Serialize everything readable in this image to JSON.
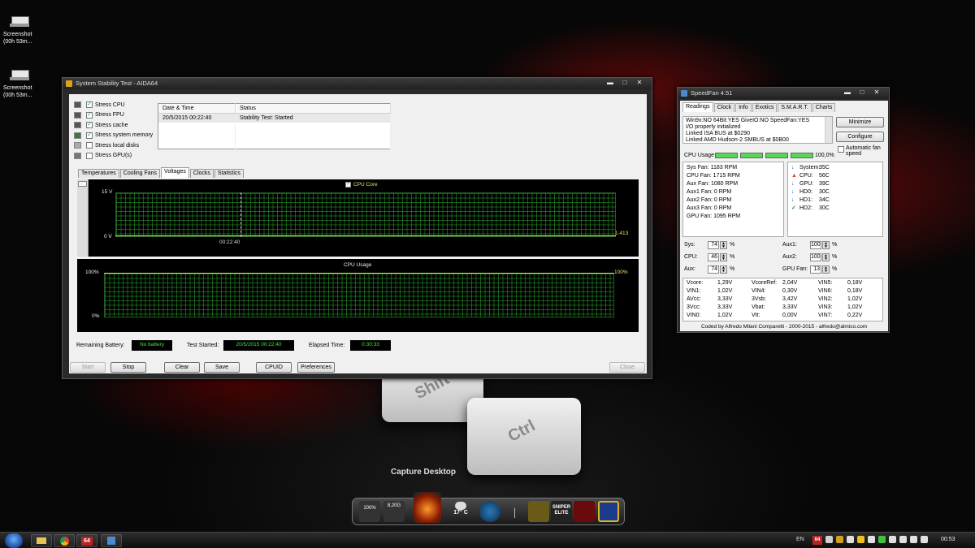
{
  "desktop": {
    "icons": [
      {
        "label": "Screenshot (00h 53m..."
      },
      {
        "label": "Screenshot (00h 53m..."
      }
    ],
    "capture_label": "Capture Desktop",
    "keys": [
      "Shift",
      "Ctrl"
    ]
  },
  "aida": {
    "title": "System Stability Test - AIDA64",
    "stress_items": [
      {
        "label": "Stress CPU",
        "checked": true
      },
      {
        "label": "Stress FPU",
        "checked": true
      },
      {
        "label": "Stress cache",
        "checked": true
      },
      {
        "label": "Stress system memory",
        "checked": true
      },
      {
        "label": "Stress local disks",
        "checked": false
      },
      {
        "label": "Stress GPU(s)",
        "checked": false
      }
    ],
    "log_headers": [
      "Date & Time",
      "Status"
    ],
    "log_rows": [
      [
        "20/5/2015 00:22:40",
        "Stability Test: Started"
      ]
    ],
    "tabs": [
      "Temperatures",
      "Cooling Fans",
      "Voltages",
      "Clocks",
      "Statistics"
    ],
    "active_tab": "Voltages",
    "graph1": {
      "legend": "CPU Core",
      "y_max": "15 V",
      "y_min": "0 V",
      "x_label": "00:22:40",
      "value": "1.413",
      "color": "#e8e060"
    },
    "graph2": {
      "title": "CPU Usage",
      "y_max": "100%",
      "y_min": "0%",
      "value": "100%",
      "color": "#e8e060"
    },
    "status": {
      "battery_label": "Remaining Battery:",
      "battery_value": "No battery",
      "started_label": "Test Started:",
      "started_value": "20/5/2015 00:22:40",
      "elapsed_label": "Elapsed Time:",
      "elapsed_value": "0:30:33"
    },
    "buttons": [
      "Start",
      "Stop",
      "Clear",
      "Save",
      "CPUID",
      "Preferences",
      "Close"
    ]
  },
  "speedfan": {
    "title": "SpeedFan 4.51",
    "tabs": [
      "Readings",
      "Clock",
      "Info",
      "Exotics",
      "S.M.A.R.T.",
      "Charts"
    ],
    "log": [
      "Win9x:NO  64Bit:YES  GiveIO:NO  SpeedFan:YES",
      "I/O properly initialized",
      "Linked ISA BUS at $0290",
      "Linked AMD Hudson-2 SMBUS at $0B00"
    ],
    "minimize_label": "Minimize",
    "configure_label": "Configure",
    "auto_fan_label": "Automatic fan speed",
    "cpu_usage_label": "CPU Usage",
    "cpu_usage_value": "100,0%",
    "cpu_usage_fraction": 1.0,
    "fans": [
      "Sys Fan: 1183 RPM",
      "CPU Fan: 1715 RPM",
      "Aux Fan: 1080 RPM",
      "Aux1 Fan: 0 RPM",
      "Aux2 Fan: 0 RPM",
      "Aux3 Fan: 0 RPM",
      "GPU Fan: 1095 RPM"
    ],
    "temps": [
      {
        "name": "System:",
        "value": "35C",
        "icon": "down-arrow-icon"
      },
      {
        "name": "CPU:",
        "value": "56C",
        "icon": "flame-icon"
      },
      {
        "name": "GPU:",
        "value": "39C",
        "icon": "down-arrow-icon"
      },
      {
        "name": "HD0:",
        "value": "30C",
        "icon": "down-arrow-icon"
      },
      {
        "name": "HD1:",
        "value": "34C",
        "icon": "down-arrow-icon"
      },
      {
        "name": "HD2:",
        "value": "30C",
        "icon": "check-icon"
      }
    ],
    "speeds": [
      {
        "label": "Sys:",
        "value": "74"
      },
      {
        "label": "CPU:",
        "value": "46"
      },
      {
        "label": "Aux:",
        "value": "74"
      },
      {
        "label": "Aux1:",
        "value": "100"
      },
      {
        "label": "Aux2:",
        "value": "100"
      },
      {
        "label": "GPU Fan:",
        "value": "13"
      }
    ],
    "percent_sign": "%",
    "voltages": [
      [
        "Vcore:",
        "1,29V",
        "VcoreRef:",
        "2,04V",
        "VIN5:",
        "0,18V"
      ],
      [
        "VIN1:",
        "1,02V",
        "VIN4:",
        "0,30V",
        "VIN6:",
        "0,18V"
      ],
      [
        "AVcc:",
        "3,33V",
        "3Vsb:",
        "3,42V",
        "VIN2:",
        "1,02V"
      ],
      [
        "3Vcc:",
        "3,33V",
        "Vbat:",
        "3,33V",
        "VIN3:",
        "1,02V"
      ],
      [
        "VIN0:",
        "1,02V",
        "Vtt:",
        "0,00V",
        "VIN7:",
        "0,22V"
      ]
    ],
    "footer": "Coded by Alfredo Milani Comparetti - 2000-2015 - alfredo@almico.com"
  },
  "dock": {
    "items": [
      "100%",
      "8,20G",
      "",
      "17° C",
      "",
      "",
      "SNIPER ELITE",
      "",
      ""
    ]
  },
  "taskbar": {
    "lang": "EN",
    "clock": "00:53",
    "pinned_aida": "64",
    "tray_aida": "64"
  }
}
